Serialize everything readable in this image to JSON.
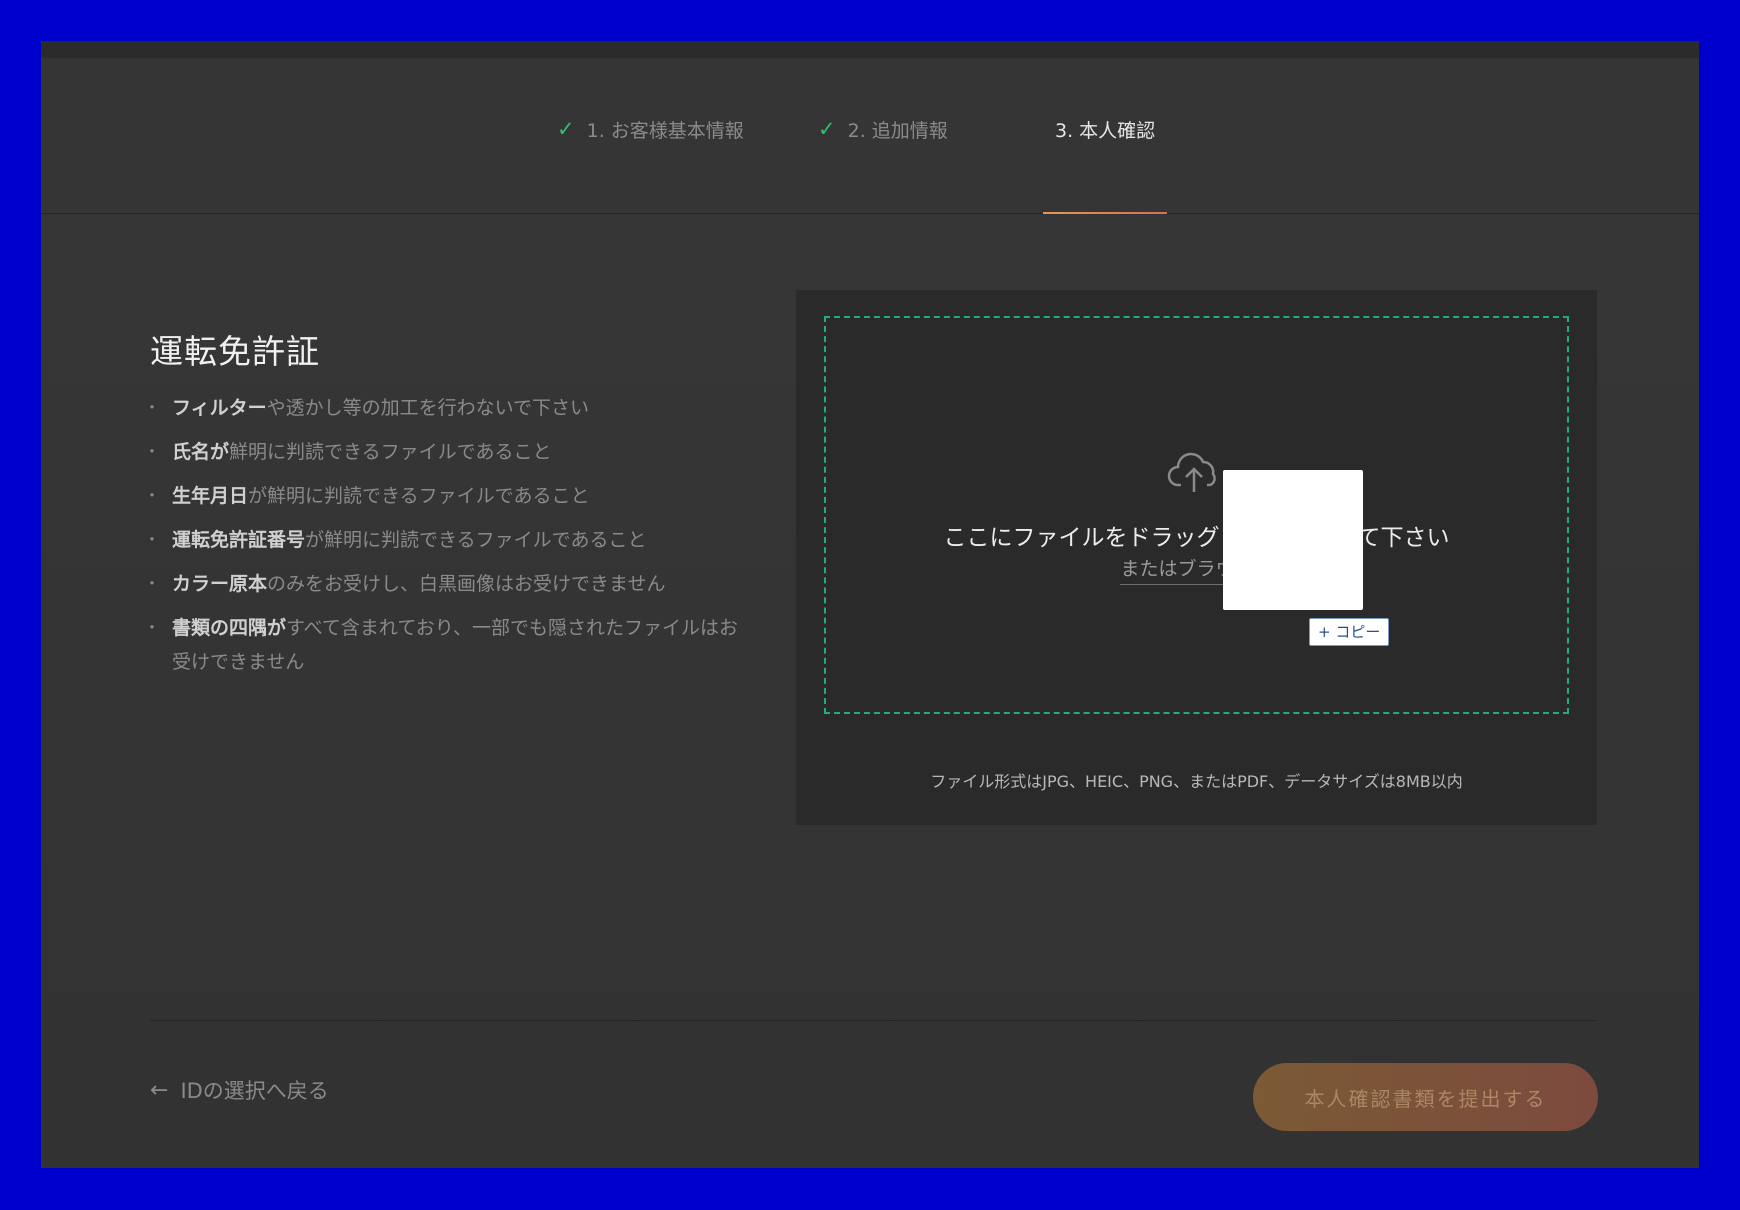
{
  "steps": [
    {
      "label": "1. お客様基本情報",
      "done": true
    },
    {
      "label": "2. 追加情報",
      "done": true
    },
    {
      "label": "3. 本人確認",
      "done": false
    }
  ],
  "check_glyph": "✓",
  "document": {
    "title": "運転免許証",
    "rules": [
      {
        "bold": "フィルター",
        "text": "や透かし等の加工を行わないで下さい"
      },
      {
        "bold": "氏名が",
        "text": "鮮明に判読できるファイルであること"
      },
      {
        "bold": "生年月日",
        "text": "が鮮明に判読できるファイルであること"
      },
      {
        "bold": "運転免許証番号",
        "text": "が鮮明に判読できるファイルであること"
      },
      {
        "bold": "カラー原本",
        "text": "のみをお受けし、白黒画像はお受けできません"
      },
      {
        "bold": "書類の四隅が",
        "text": "すべて含まれており、一部でも隠されたファイルはお受けできません"
      }
    ]
  },
  "upload": {
    "icon": "cloud-upload-icon",
    "main_text": "ここにファイルをドラッグ　　　　　　て下さい",
    "sub_text": "またはブラウザか",
    "copy_badge": "+ コピー",
    "format_note": "ファイル形式はJPG、HEIC、PNG、またはPDF、データサイズは8MB以内",
    "accent_color": "#1fae74"
  },
  "footer": {
    "back_arrow": "←",
    "back_label": "IDの選択へ戻る",
    "submit_label": "本人確認書類を提出する"
  }
}
